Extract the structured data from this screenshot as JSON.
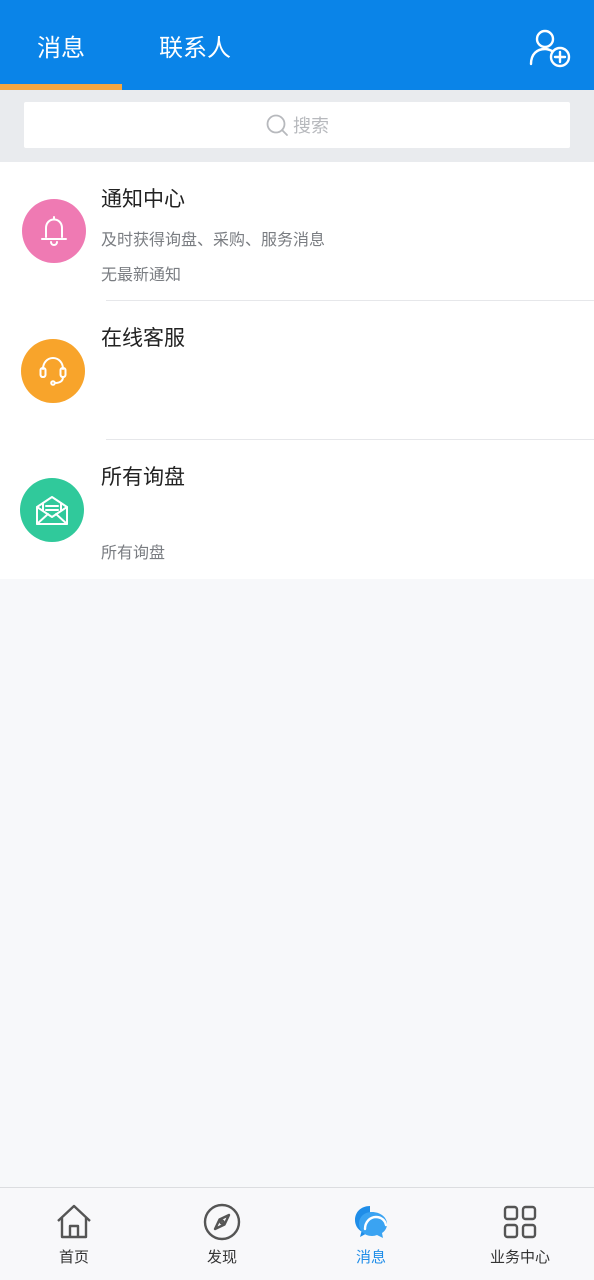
{
  "header": {
    "tabs": [
      {
        "label": "消息",
        "active": true
      },
      {
        "label": "联系人",
        "active": false
      }
    ],
    "add_contact_icon": "add-contact-icon",
    "colors": {
      "background": "#0a84e8",
      "indicator": "#f5a640"
    }
  },
  "search": {
    "placeholder": "搜索"
  },
  "items": [
    {
      "title": "通知中心",
      "subtitle": "及时获得询盘、采购、服务消息",
      "detail": "无最新通知",
      "icon": "bell-icon",
      "color": "#ef7ab3"
    },
    {
      "title": "在线客服",
      "subtitle": "",
      "detail": "",
      "icon": "headset-icon",
      "color": "#f8a42b"
    },
    {
      "title": "所有询盘",
      "subtitle": "",
      "detail": "所有询盘",
      "icon": "envelope-icon",
      "color": "#30c99b"
    }
  ],
  "bottom_nav": {
    "items": [
      {
        "label": "首页",
        "icon": "home-icon",
        "active": false
      },
      {
        "label": "发现",
        "icon": "compass-icon",
        "active": false
      },
      {
        "label": "消息",
        "icon": "chat-bubbles-icon",
        "active": true
      },
      {
        "label": "业务中心",
        "icon": "grid-icon",
        "active": false
      }
    ],
    "active_color": "#1f8de8"
  }
}
